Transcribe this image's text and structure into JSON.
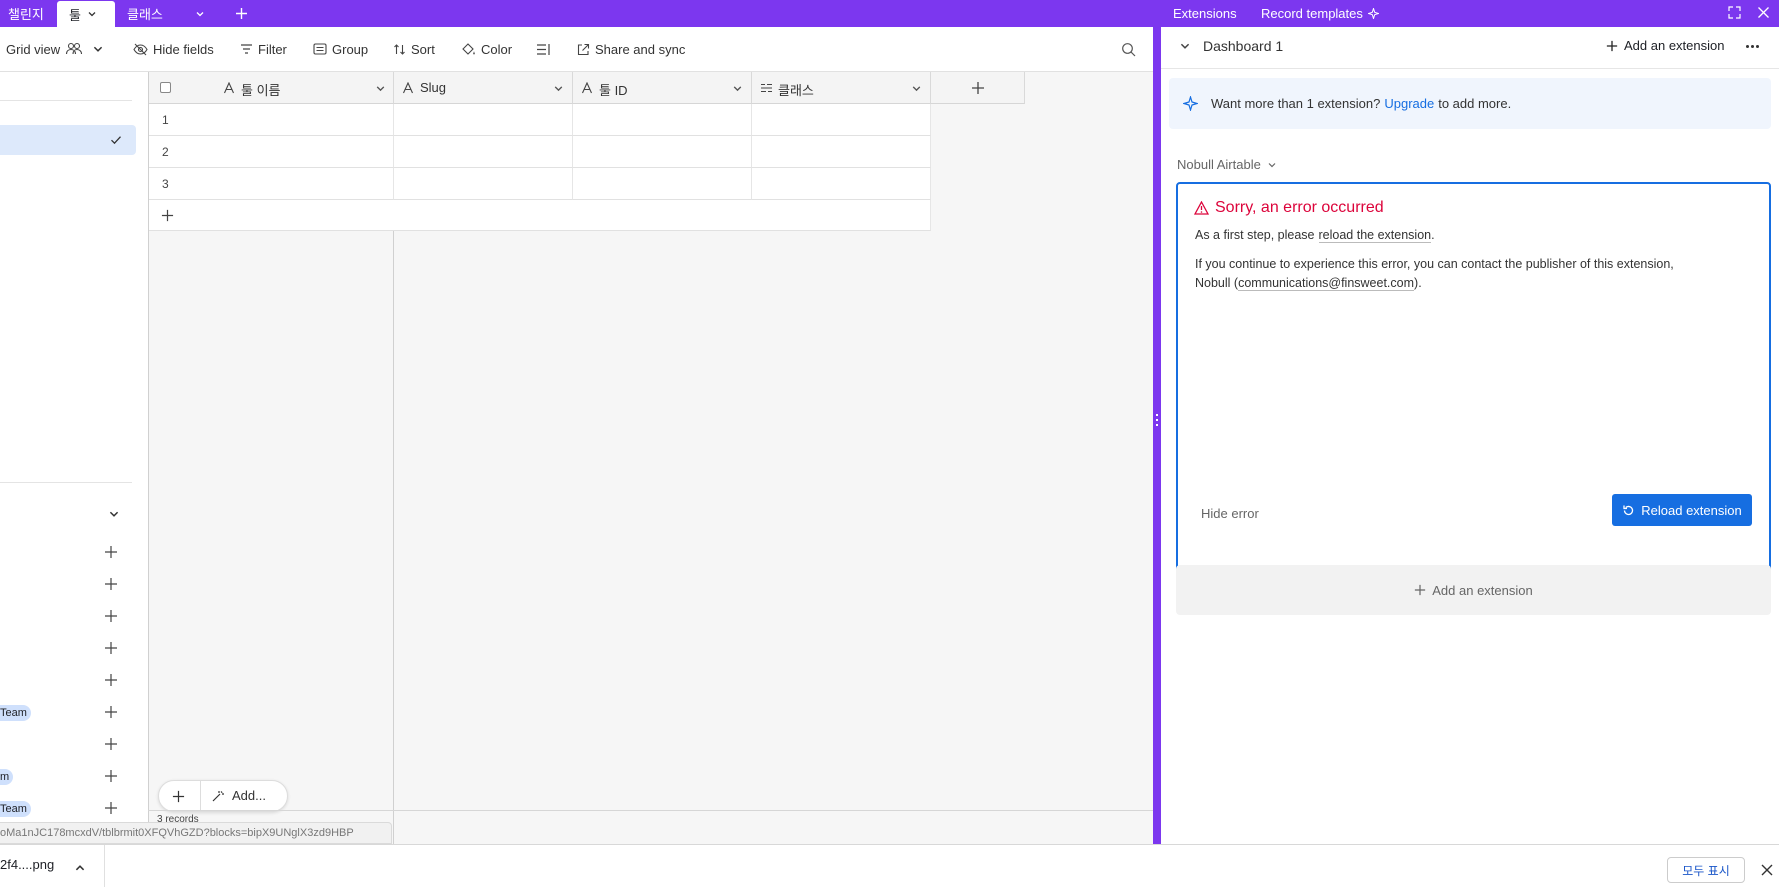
{
  "tabs": [
    {
      "label": "챌린지"
    },
    {
      "label": "툴"
    },
    {
      "label": "클래스"
    }
  ],
  "toolbar": {
    "grid_view": "Grid view",
    "hide_fields": "Hide fields",
    "filter": "Filter",
    "group": "Group",
    "sort": "Sort",
    "color": "Color",
    "share": "Share and sync"
  },
  "grid": {
    "columns": [
      {
        "label": "툴 이름",
        "icon": "text-icon"
      },
      {
        "label": "Slug",
        "icon": "text-icon"
      },
      {
        "label": "툴 ID",
        "icon": "text-icon"
      },
      {
        "label": "클래스",
        "icon": "link-list-icon"
      }
    ],
    "rows": [
      "1",
      "2",
      "3"
    ],
    "add_label": "Add...",
    "record_count": "3 records"
  },
  "sidebar": {
    "badges": [
      "Team",
      "m",
      "Team"
    ]
  },
  "status_url": "oMa1nJC178mcxdV/tblbrmit0XFQVhGZD?blocks=bipX9UNglX3zd9HBP",
  "right": {
    "tabs": {
      "extensions": "Extensions",
      "record_templates": "Record templates"
    },
    "dashboard": "Dashboard 1",
    "add_extension": "Add an extension",
    "upgrade_banner": {
      "text": "Want more than 1 extension?",
      "link": "Upgrade",
      "suffix": "to add more."
    },
    "extension_name": "Nobull Airtable",
    "error": {
      "title": "Sorry, an error occurred",
      "line1_prefix": "As a first step, please",
      "line1_link": "reload the extension",
      "line1_suffix": ".",
      "line2": "If you continue to experience this error, you can contact the publisher of this extension,",
      "line3_prefix": "Nobull (",
      "line3_link": "communications@finsweet.com",
      "line3_suffix": ").",
      "hide": "Hide error",
      "reload": "Reload extension"
    },
    "add_extension_bottom": "Add an extension"
  },
  "download": {
    "file": "2f4....png",
    "show_all": "모두 표시"
  },
  "colors": {
    "accent": "#7c37ef",
    "primary": "#166ee1",
    "error": "#dc043b"
  }
}
